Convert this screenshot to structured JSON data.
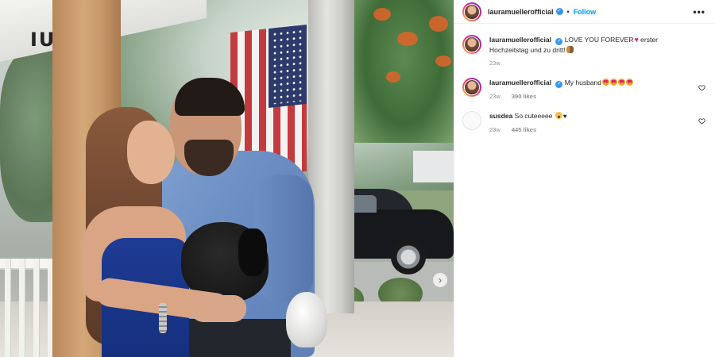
{
  "post_header": {
    "username": "lauramuellerofficial",
    "separator": "•",
    "follow_label": "Follow",
    "more_label": "•••"
  },
  "photo": {
    "roof_sign": "IU",
    "next_label": "›"
  },
  "caption": {
    "username": "lauramuellerofficial",
    "text": "LOVE YOU FOREVER",
    "text_after": " erster Hochzeitstag und zu dritt!",
    "time": "23w"
  },
  "comments": [
    {
      "username": "lauramuellerofficial",
      "text": "My husband",
      "time": "23w",
      "likes": "390 likes",
      "emoji": [
        "smiling-face-with-heart-eyes",
        "smiling-face-with-heart-eyes",
        "smiling-face-with-heart-eyes",
        "smiling-face-with-heart-eyes"
      ]
    },
    {
      "username": "susdea",
      "text": "So cuteeeee",
      "time": "23w",
      "likes": "445 likes",
      "emoji": [
        "crying-face",
        "black-heart"
      ]
    }
  ],
  "colors": {
    "accent": "#0095f6",
    "verified": "#3897f0",
    "text": "#262626",
    "muted": "#8e8e8e"
  },
  "icons": {
    "verified": "verified-badge-icon",
    "like": "heart-outline-icon",
    "more": "more-options-icon"
  }
}
